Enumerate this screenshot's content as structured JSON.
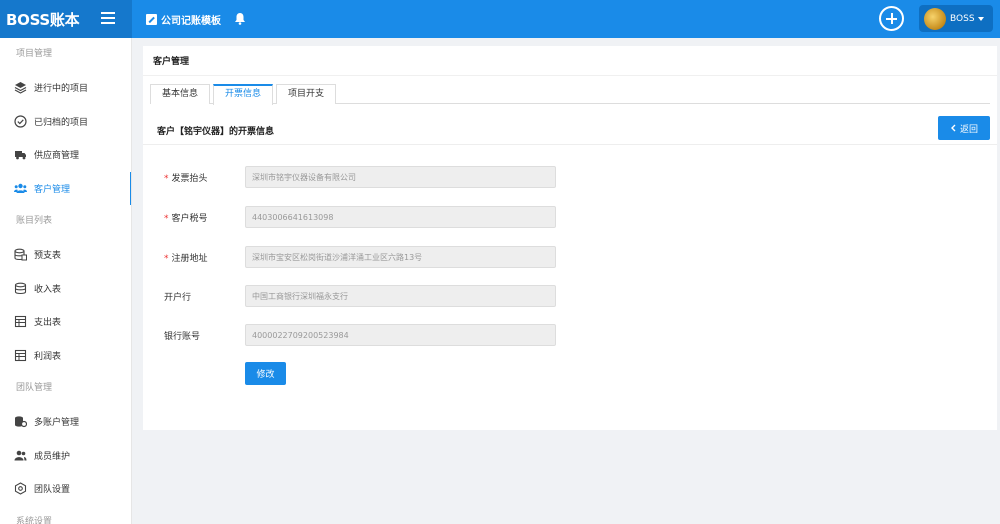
{
  "app": {
    "brand": "BOSS账本"
  },
  "topbar": {
    "template_link": "公司记账模板",
    "user_name": "BOSS"
  },
  "sidebar": {
    "groups": [
      "项目管理",
      "账目列表",
      "团队管理",
      "系统设置"
    ],
    "items": [
      {
        "label": "进行中的项目",
        "icon": "layers-icon"
      },
      {
        "label": "已归档的项目",
        "icon": "check-circle-icon"
      },
      {
        "label": "供应商管理",
        "icon": "truck-icon"
      },
      {
        "label": "客户管理",
        "icon": "users-icon"
      },
      {
        "label": "预支表",
        "icon": "database-icon"
      },
      {
        "label": "收入表",
        "icon": "database-icon"
      },
      {
        "label": "支出表",
        "icon": "table-icon"
      },
      {
        "label": "利润表",
        "icon": "table-icon"
      },
      {
        "label": "多账户管理",
        "icon": "coins-icon"
      },
      {
        "label": "成员维护",
        "icon": "user-group-icon"
      },
      {
        "label": "团队设置",
        "icon": "settings-icon"
      }
    ],
    "active": "客户管理"
  },
  "main": {
    "title": "客户管理",
    "tabs": [
      {
        "label": "基本信息"
      },
      {
        "label": "开票信息"
      },
      {
        "label": "项目开支"
      }
    ],
    "active_tab": "开票信息",
    "section_title": "客户【铭宇仪器】的开票信息",
    "back_label": "返回",
    "fields": [
      {
        "label": "发票抬头",
        "required": true,
        "value": "深圳市铭宇仪器设备有限公司"
      },
      {
        "label": "客户税号",
        "required": true,
        "value": "4403006641613098"
      },
      {
        "label": "注册地址",
        "required": true,
        "value": "深圳市宝安区松岗街道沙浦洋涌工业区六路13号"
      },
      {
        "label": "开户行",
        "required": false,
        "value": "中国工商银行深圳福永支行"
      },
      {
        "label": "银行账号",
        "required": false,
        "value": "4000022709200523984"
      }
    ],
    "submit_label": "修改"
  },
  "colors": {
    "primary": "#1a8be8",
    "brand_bg": "#1578cc",
    "required": "#e33333"
  }
}
